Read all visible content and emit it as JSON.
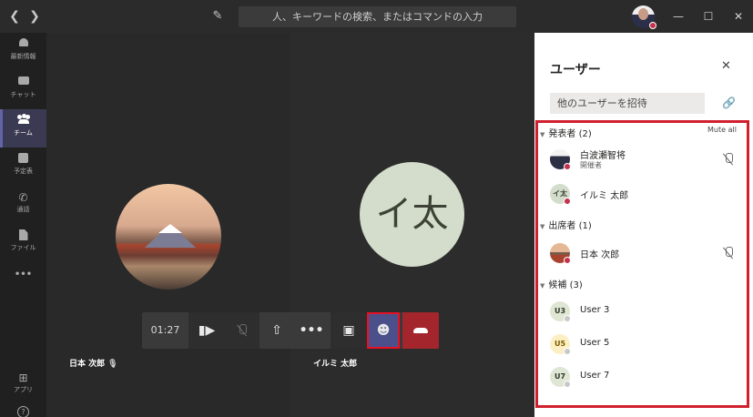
{
  "titlebar": {
    "back_icon": "chevron-left-icon",
    "forward_icon": "chevron-right-icon",
    "search_placeholder": "人、キーワードの検索、またはコマンドの入力"
  },
  "rail": {
    "items": [
      {
        "label": "最新情報",
        "icon": "bell-icon"
      },
      {
        "label": "チャット",
        "icon": "chat-icon"
      },
      {
        "label": "チーム",
        "icon": "teams-icon",
        "active": true
      },
      {
        "label": "予定表",
        "icon": "calendar-icon"
      },
      {
        "label": "通話",
        "icon": "phone-icon"
      },
      {
        "label": "ファイル",
        "icon": "file-icon"
      },
      {
        "label": "•••",
        "icon": "more-icon"
      },
      {
        "label": "アプリ",
        "icon": "apps-icon"
      },
      {
        "label": "?",
        "icon": "help-icon"
      }
    ]
  },
  "stage": {
    "left_participant": "日本 次郎",
    "right_participant": "イルミ 太郎",
    "right_initials": "イ太"
  },
  "controls": {
    "timer": "01:27"
  },
  "panel": {
    "title": "ユーザー",
    "invite_placeholder": "他のユーザーを招待",
    "mute_all": "Mute all",
    "sections": {
      "presenters": "発表者 (2)",
      "attendees": "出席者 (1)",
      "candidates": "候補 (3)"
    },
    "people": {
      "p1_name": "白波瀬智将",
      "p1_role": "開催者",
      "p2_name": "イルミ 太郎",
      "p2_initials": "イ太",
      "p3_name": "日本 次郎",
      "u3_name": "User 3",
      "u3_initials": "U3",
      "u5_name": "User 5",
      "u5_initials": "U5",
      "u7_name": "User 7",
      "u7_initials": "U7"
    }
  },
  "colors": {
    "accent": "#6264a7",
    "hangup": "#a4262c",
    "highlight_border": "#d0202d",
    "busy": "#c4314b"
  }
}
